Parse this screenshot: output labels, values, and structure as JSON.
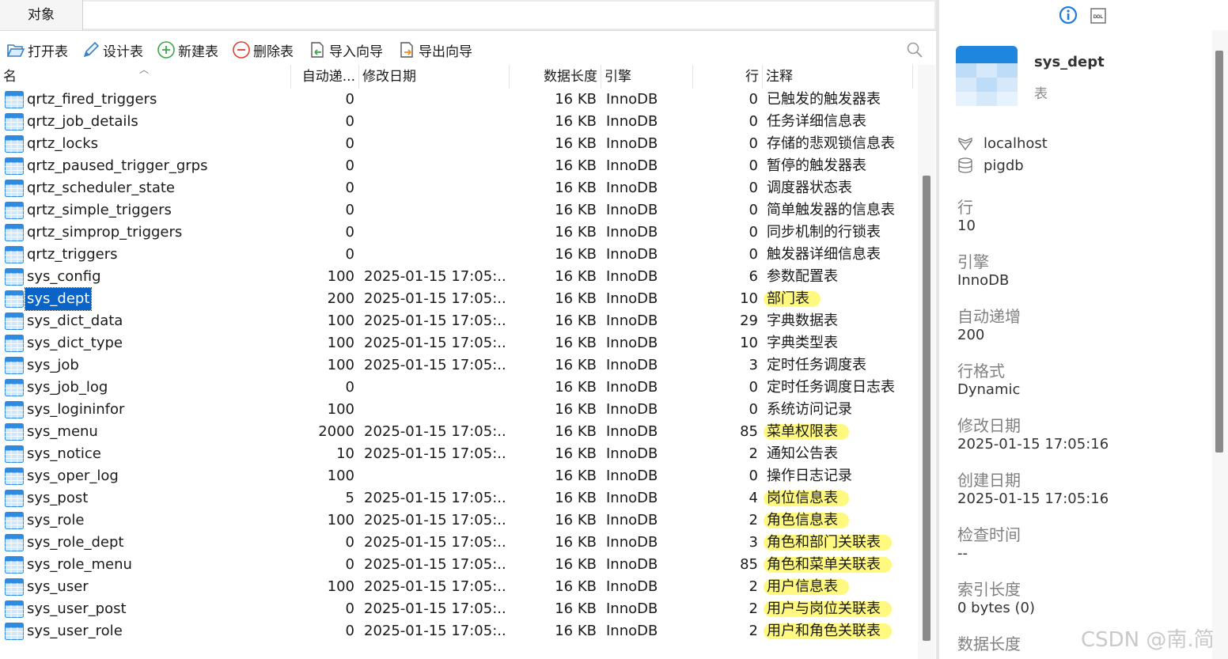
{
  "tabs": {
    "objects": "对象"
  },
  "toolbar": {
    "open_table": "打开表",
    "design_table": "设计表",
    "new_table": "新建表",
    "delete_table": "删除表",
    "import_wizard": "导入向导",
    "export_wizard": "导出向导"
  },
  "columns": {
    "name": "名",
    "auto_increment": "自动递...",
    "modified": "修改日期",
    "data_length": "数据长度",
    "engine": "引擎",
    "rows": "行",
    "comment": "注释"
  },
  "tables": [
    {
      "name": "qrtz_fired_triggers",
      "auto": "0",
      "date": "",
      "len": "16 KB",
      "engine": "InnoDB",
      "rows": "0",
      "comment": "已触发的触发器表",
      "hl": 0
    },
    {
      "name": "qrtz_job_details",
      "auto": "0",
      "date": "",
      "len": "16 KB",
      "engine": "InnoDB",
      "rows": "0",
      "comment": "任务详细信息表",
      "hl": 0
    },
    {
      "name": "qrtz_locks",
      "auto": "0",
      "date": "",
      "len": "16 KB",
      "engine": "InnoDB",
      "rows": "0",
      "comment": "存储的悲观锁信息表",
      "hl": 0
    },
    {
      "name": "qrtz_paused_trigger_grps",
      "auto": "0",
      "date": "",
      "len": "16 KB",
      "engine": "InnoDB",
      "rows": "0",
      "comment": "暂停的触发器表",
      "hl": 0
    },
    {
      "name": "qrtz_scheduler_state",
      "auto": "0",
      "date": "",
      "len": "16 KB",
      "engine": "InnoDB",
      "rows": "0",
      "comment": "调度器状态表",
      "hl": 0
    },
    {
      "name": "qrtz_simple_triggers",
      "auto": "0",
      "date": "",
      "len": "16 KB",
      "engine": "InnoDB",
      "rows": "0",
      "comment": "简单触发器的信息表",
      "hl": 0
    },
    {
      "name": "qrtz_simprop_triggers",
      "auto": "0",
      "date": "",
      "len": "16 KB",
      "engine": "InnoDB",
      "rows": "0",
      "comment": "同步机制的行锁表",
      "hl": 0
    },
    {
      "name": "qrtz_triggers",
      "auto": "0",
      "date": "",
      "len": "16 KB",
      "engine": "InnoDB",
      "rows": "0",
      "comment": "触发器详细信息表",
      "hl": 0
    },
    {
      "name": "sys_config",
      "auto": "100",
      "date": "2025-01-15 17:05:...",
      "len": "16 KB",
      "engine": "InnoDB",
      "rows": "6",
      "comment": "参数配置表",
      "hl": 0
    },
    {
      "name": "sys_dept",
      "auto": "200",
      "date": "2025-01-15 17:05:...",
      "len": "16 KB",
      "engine": "InnoDB",
      "rows": "10",
      "comment": "部门表",
      "hl": 1,
      "selected": true
    },
    {
      "name": "sys_dict_data",
      "auto": "100",
      "date": "2025-01-15 17:05:...",
      "len": "16 KB",
      "engine": "InnoDB",
      "rows": "29",
      "comment": "字典数据表",
      "hl": 0
    },
    {
      "name": "sys_dict_type",
      "auto": "100",
      "date": "2025-01-15 17:05:...",
      "len": "16 KB",
      "engine": "InnoDB",
      "rows": "10",
      "comment": "字典类型表",
      "hl": 0
    },
    {
      "name": "sys_job",
      "auto": "100",
      "date": "2025-01-15 17:05:...",
      "len": "16 KB",
      "engine": "InnoDB",
      "rows": "3",
      "comment": "定时任务调度表",
      "hl": 0
    },
    {
      "name": "sys_job_log",
      "auto": "0",
      "date": "",
      "len": "16 KB",
      "engine": "InnoDB",
      "rows": "0",
      "comment": "定时任务调度日志表",
      "hl": 0
    },
    {
      "name": "sys_logininfor",
      "auto": "100",
      "date": "",
      "len": "16 KB",
      "engine": "InnoDB",
      "rows": "0",
      "comment": "系统访问记录",
      "hl": 0
    },
    {
      "name": "sys_menu",
      "auto": "2000",
      "date": "2025-01-15 17:05:...",
      "len": "16 KB",
      "engine": "InnoDB",
      "rows": "85",
      "comment": "菜单权限表",
      "hl": 1
    },
    {
      "name": "sys_notice",
      "auto": "10",
      "date": "2025-01-15 17:05:...",
      "len": "16 KB",
      "engine": "InnoDB",
      "rows": "2",
      "comment": "通知公告表",
      "hl": 0
    },
    {
      "name": "sys_oper_log",
      "auto": "100",
      "date": "",
      "len": "16 KB",
      "engine": "InnoDB",
      "rows": "0",
      "comment": "操作日志记录",
      "hl": 0
    },
    {
      "name": "sys_post",
      "auto": "5",
      "date": "2025-01-15 17:05:...",
      "len": "16 KB",
      "engine": "InnoDB",
      "rows": "4",
      "comment": "岗位信息表",
      "hl": 1
    },
    {
      "name": "sys_role",
      "auto": "100",
      "date": "2025-01-15 17:05:...",
      "len": "16 KB",
      "engine": "InnoDB",
      "rows": "2",
      "comment": "角色信息表",
      "hl": 1
    },
    {
      "name": "sys_role_dept",
      "auto": "0",
      "date": "2025-01-15 17:05:...",
      "len": "16 KB",
      "engine": "InnoDB",
      "rows": "3",
      "comment": "角色和部门关联表",
      "hl": 1
    },
    {
      "name": "sys_role_menu",
      "auto": "0",
      "date": "2025-01-15 17:05:...",
      "len": "16 KB",
      "engine": "InnoDB",
      "rows": "85",
      "comment": "角色和菜单关联表",
      "hl": 1
    },
    {
      "name": "sys_user",
      "auto": "100",
      "date": "2025-01-15 17:05:...",
      "len": "16 KB",
      "engine": "InnoDB",
      "rows": "2",
      "comment": "用户信息表",
      "hl": 1
    },
    {
      "name": "sys_user_post",
      "auto": "0",
      "date": "2025-01-15 17:05:...",
      "len": "16 KB",
      "engine": "InnoDB",
      "rows": "2",
      "comment": "用户与岗位关联表",
      "hl": 1
    },
    {
      "name": "sys_user_role",
      "auto": "0",
      "date": "2025-01-15 17:05:...",
      "len": "16 KB",
      "engine": "InnoDB",
      "rows": "2",
      "comment": "用户和角色关联表",
      "hl": 1
    }
  ],
  "detail": {
    "name": "sys_dept",
    "type": "表",
    "host": "localhost",
    "database": "pigdb",
    "props": [
      {
        "label": "行",
        "value": "10"
      },
      {
        "label": "引擎",
        "value": "InnoDB"
      },
      {
        "label": "自动递增",
        "value": "200"
      },
      {
        "label": "行格式",
        "value": "Dynamic"
      },
      {
        "label": "修改日期",
        "value": "2025-01-15 17:05:16"
      },
      {
        "label": "创建日期",
        "value": "2025-01-15 17:05:16"
      },
      {
        "label": "检查时间",
        "value": "--"
      },
      {
        "label": "索引长度",
        "value": "0 bytes (0)"
      },
      {
        "label": "数据长度",
        "value": ""
      }
    ]
  },
  "watermark": "CSDN @南.简",
  "colors": {
    "selection": "#0a64c8",
    "highlight": "#fff86a",
    "icon_blue": "#2f8be0"
  }
}
